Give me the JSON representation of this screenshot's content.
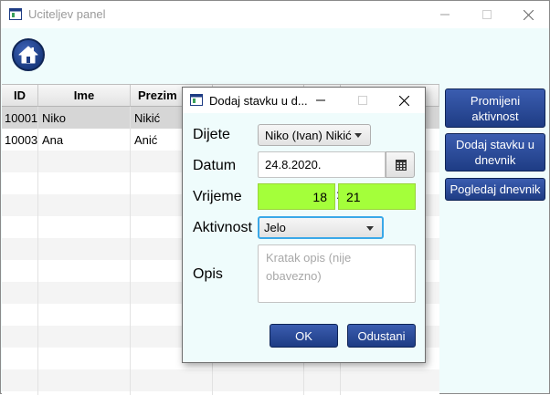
{
  "main_window": {
    "title": "Uciteljev panel"
  },
  "table": {
    "columns": [
      "ID",
      "Ime",
      "Prezim"
    ],
    "rows": [
      {
        "id": "10001",
        "ime": "Niko",
        "prezime": "Nikić"
      },
      {
        "id": "10003",
        "ime": "Ana",
        "prezime": "Anić"
      }
    ]
  },
  "side_buttons": {
    "change_activity": "Promijeni aktivnost",
    "add_entry": "Dodaj stavku u dnevnik",
    "view_journal": "Pogledaj dnevnik"
  },
  "dialog": {
    "title": "Dodaj stavku u d...",
    "child_label": "Dijete",
    "child_value": "Niko (Ivan) Nikić",
    "date_label": "Datum",
    "date_value": "24.8.2020.",
    "time_label": "Vrijeme",
    "hour": "18",
    "time_separator": ":",
    "minute": "21",
    "activity_label": "Aktivnost",
    "activity_value": "Jelo",
    "description_label": "Opis",
    "description_placeholder": "Kratak opis (nije obavezno)",
    "ok_label": "OK",
    "cancel_label": "Odustani"
  },
  "colors": {
    "accent_button": "#2a4a9a",
    "time_field": "#a4ff3a",
    "window_bg": "#effcfc"
  },
  "icons": [
    "app-icon",
    "home-icon",
    "calendar-icon",
    "minimize-icon",
    "maximize-icon",
    "close-icon"
  ]
}
